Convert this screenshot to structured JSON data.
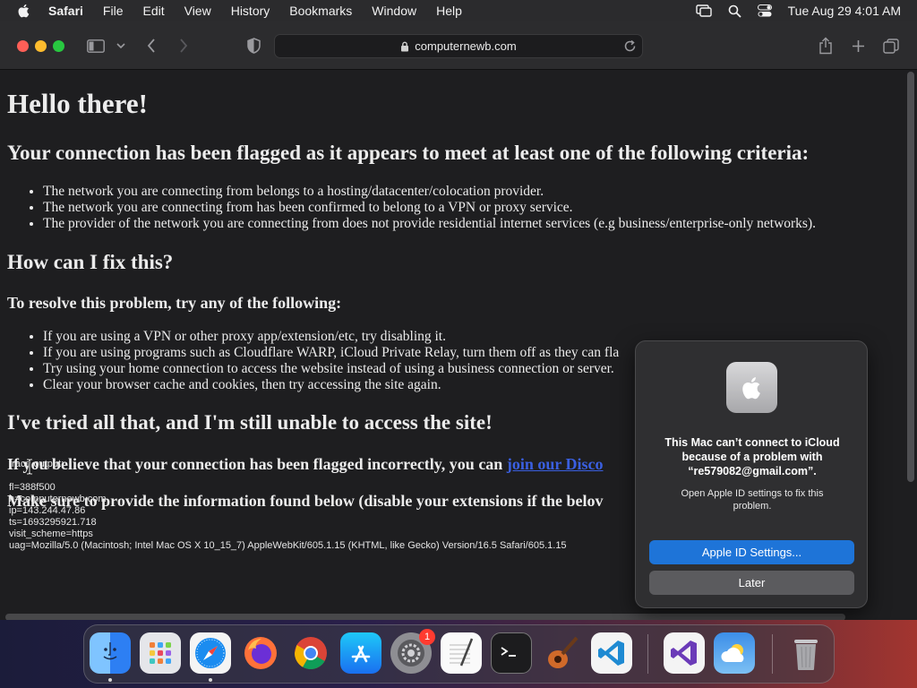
{
  "menubar": {
    "app_name": "Safari",
    "items": [
      "File",
      "Edit",
      "View",
      "History",
      "Bookmarks",
      "Window",
      "Help"
    ],
    "clock": "Tue Aug 29  4:01 AM"
  },
  "toolbar": {
    "url": "computernewb.com"
  },
  "page": {
    "h1": "Hello there!",
    "h2_flagged": "Your connection has been flagged as it appears to meet at least one of the following criteria:",
    "criteria": [
      "The network you are connecting from belongs to a hosting/datacenter/colocation provider.",
      "The network you are connecting from has been confirmed to belong to a VPN or proxy service.",
      "The provider of the network you are connecting from does not provide residential internet services (e.g business/enterprise-only networks)."
    ],
    "h2_fix": "How can I fix this?",
    "h3_resolve": "To resolve this problem, try any of the following:",
    "fixes": [
      "If you are using a VPN or other proxy app/extension/etc, try disabling it.",
      "If you are using programs such as Cloudflare WARP, iCloud Private Relay, turn them off as they can fla",
      "Try using your home connection to access the website instead of using a business connection or server.",
      "Clear your browser cache and cookies, then try accessing the site again."
    ],
    "h2_tried": "I've tried all that, and I'm still unable to access the site!",
    "believe_text": "If you believe that your connection has been flagged incorrectly, you can ",
    "believe_link": "join our Disco",
    "provide_text": "Make sure to provide the information found below (disable your extensions if the belov",
    "trace": "trace output:\n\nfl=388f500\nh=computernewb.com\nip=143.244.47.86\nts=1693295921.718\nvisit_scheme=https\nuag=Mozilla/5.0 (Macintosh; Intel Mac OS X 10_15_7) AppleWebKit/605.1.15 (KHTML, like Gecko) Version/16.5 Safari/605.1.15"
  },
  "notification": {
    "title": "This Mac can’t connect to iCloud because of a problem with “re579082@gmail.com”.",
    "body": "Open Apple ID settings to fix this problem.",
    "primary_button": "Apple ID Settings...",
    "secondary_button": "Later"
  },
  "dock": {
    "badge_count": "1",
    "apps": [
      "finder-icon",
      "launchpad-icon",
      "safari-icon",
      "firefox-icon",
      "chrome-icon",
      "app-store-icon",
      "system-settings-icon",
      "textedit-icon",
      "terminal-icon",
      "garageband-icon",
      "vscode-icon",
      "visual-studio-icon",
      "weather-icon",
      "trash-icon"
    ]
  },
  "colors": {
    "accent": "#1e74d8",
    "link": "#3a5fe0",
    "close": "#ff5f57",
    "minimize": "#febc2e",
    "zoom": "#28c840"
  }
}
